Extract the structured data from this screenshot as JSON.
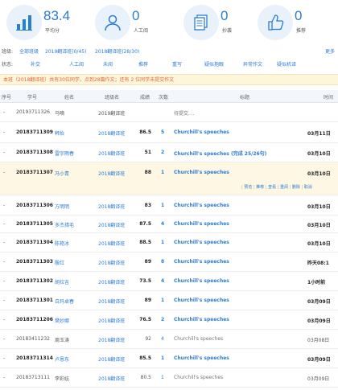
{
  "stats": [
    {
      "value": "83.4",
      "label": "平均分",
      "icon": "chart-bars-icon"
    },
    {
      "value": "0",
      "label": "人工阅",
      "icon": "person-icon"
    },
    {
      "value": "0",
      "label": "抄袭",
      "icon": "documents-icon"
    },
    {
      "value": "0",
      "label": "推荐",
      "icon": "thumbs-up-icon"
    }
  ],
  "filters": {
    "class_key": "班级:",
    "class_options": [
      "全部班级",
      "2019翻译班(0/45)",
      "2018翻译班(28/30)"
    ],
    "more": "更多",
    "status_key": "状态:",
    "status_options": [
      "补交",
      "人工阅",
      "未阅",
      "推荐",
      "重写",
      "疑似抱眼",
      "异常作文",
      "疑似机译"
    ]
  },
  "notice": "本班（2018翻译班）共有30位同学，点到28篇作文；还有 2 位同学未提交作文",
  "header": {
    "index": "序号",
    "student_id": "学号",
    "name": "姓名",
    "class": "班级名",
    "score": "成绩",
    "count": "次数",
    "title": "标题",
    "time": "时间"
  },
  "rows": [
    {
      "dot": "-",
      "sid": "20193711326",
      "name": "马嘀",
      "cls": "2019翻译班",
      "score": "",
      "count": "",
      "title": "待提交....",
      "time": "",
      "plain": true
    },
    {
      "dot": "-",
      "sid": "20183711309",
      "name": "韩怡",
      "cls": "2018翻译班",
      "score": "86.5",
      "count": "5",
      "title": "Churchill's speeches",
      "time": "03月11日",
      "plain": false
    },
    {
      "dot": "-",
      "sid": "20183711308",
      "name": "雷宇雨春",
      "cls": "2018翻译班",
      "score": "51",
      "count": "2",
      "title": "Churchill's speeches (完成 25/26句)",
      "time": "03月10日",
      "plain": false
    },
    {
      "dot": "-",
      "sid": "20183711307",
      "name": "冯小青",
      "cls": "2018翻译班",
      "score": "88",
      "count": "1",
      "title": "Churchill's speeches",
      "time": "03月10日",
      "plain": false,
      "hl": true
    },
    {
      "dot": "-",
      "sid": "20183711306",
      "name": "方明明",
      "cls": "2018翻译班",
      "score": "83",
      "count": "1",
      "title": "Churchill's speeches",
      "time": "03月10日",
      "plain": false
    },
    {
      "dot": "-",
      "sid": "20183711305",
      "name": "多杰措毛",
      "cls": "2018翻译班",
      "score": "87.5",
      "count": "4",
      "title": "Churchill's speeches",
      "time": "03月10日",
      "plain": false
    },
    {
      "dot": "-",
      "sid": "20183711304",
      "name": "陈艳冰",
      "cls": "2018翻译班",
      "score": "88.5",
      "count": "1",
      "title": "Churchill's speeches",
      "time": "03月10日",
      "plain": false
    },
    {
      "dot": "-",
      "sid": "20183711303",
      "name": "殷红",
      "cls": "2018翻译班",
      "score": "89",
      "count": "8",
      "title": "Churchill's speeches",
      "time": "昨天08:1",
      "plain": false
    },
    {
      "dot": "-",
      "sid": "20183711302",
      "name": "胡拉吉",
      "cls": "2018翻译班",
      "score": "73.5",
      "count": "4",
      "title": "Churchill's speeches",
      "time": "1小时前",
      "plain": false
    },
    {
      "dot": "-",
      "sid": "20183711301",
      "name": "白玛卓春",
      "cls": "2018翻译班",
      "score": "89",
      "count": "1",
      "title": "Churchill's speeches",
      "time": "03月09日",
      "plain": false
    },
    {
      "dot": "-",
      "sid": "20183711206",
      "name": "樊妙娜",
      "cls": "2018翻译班",
      "score": "76.5",
      "count": "2",
      "title": "Churchill's speeches",
      "time": "03月09日",
      "plain": false
    },
    {
      "dot": "-",
      "sid": "20183411232",
      "name": "周玉涛",
      "cls": "2018翻译班",
      "score": "92",
      "count": "4",
      "title": "Churchill's speeches",
      "time": "03月08日",
      "plain": true
    },
    {
      "dot": "-",
      "sid": "20183711314",
      "name": "卢恩东",
      "cls": "2018翻译班",
      "score": "85.5",
      "count": "1",
      "title": "Churchill's speeches",
      "time": "03月09日",
      "plain": false
    },
    {
      "dot": "-",
      "sid": "20183713111",
      "name": "李彩娃",
      "cls": "2018翻译班",
      "score": "80.5",
      "count": "1",
      "title": "Churchill's speeches",
      "time": "03月09日",
      "plain": true
    }
  ],
  "row_actions": [
    "预览",
    "推荐",
    "查看",
    "重阅",
    "删除",
    "取消"
  ],
  "colors": {
    "accent": "#2b7cd3",
    "notice_text": "#e0693a",
    "highlight": "#fdf7e3"
  }
}
